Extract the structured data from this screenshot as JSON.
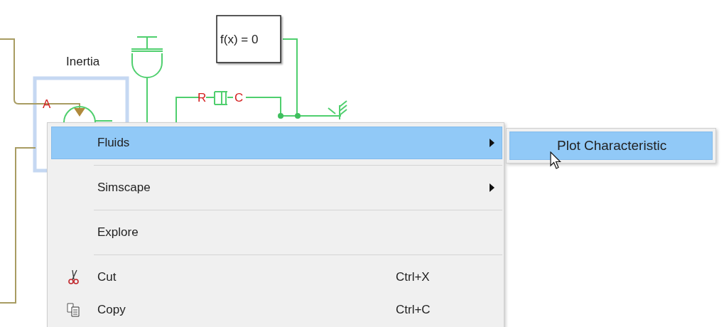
{
  "diagram": {
    "block_label": "Inertia",
    "equation": "f(x) = 0",
    "port_labels": [
      "A",
      "R",
      "C"
    ]
  },
  "context_menu": {
    "items": [
      {
        "label": "Fluids",
        "kind": "submenu",
        "selected": true,
        "separator_after": true
      },
      {
        "label": "Simscape",
        "kind": "submenu",
        "selected": false,
        "separator_after": true
      },
      {
        "label": "Explore",
        "kind": "plain",
        "selected": false,
        "separator_after": true
      },
      {
        "label": "Cut",
        "kind": "cut",
        "shortcut": "Ctrl+X",
        "selected": false,
        "separator_after": false
      },
      {
        "label": "Copy",
        "kind": "copy",
        "shortcut": "Ctrl+C",
        "selected": false,
        "separator_after": false
      }
    ]
  },
  "submenu": {
    "items": [
      {
        "label": "Plot Characteristic",
        "selected": true
      }
    ]
  }
}
